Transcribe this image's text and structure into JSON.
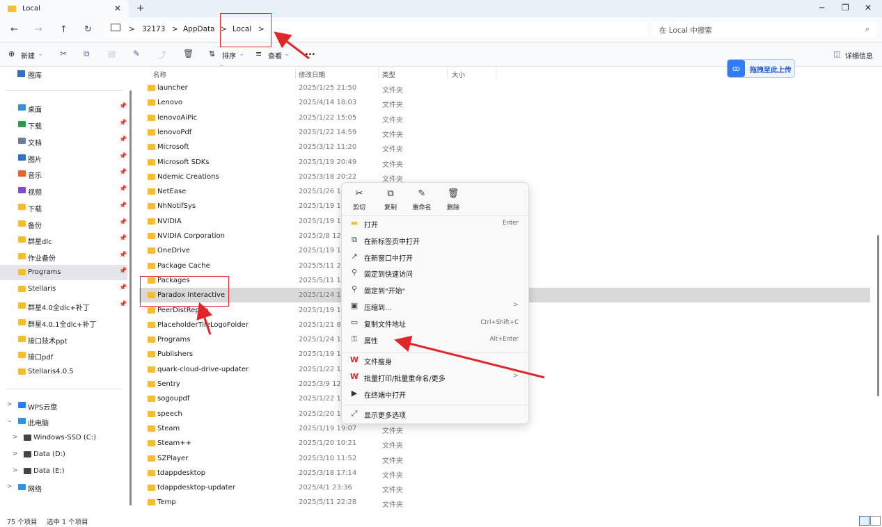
{
  "window": {
    "tab_title": "Local",
    "tab_close": "✕",
    "new_tab": "+",
    "minimize": "─",
    "maximize": "❐",
    "close": "✕"
  },
  "nav": {
    "back": "←",
    "forward": "→",
    "up": "↑",
    "refresh": "↻"
  },
  "breadcrumb": {
    "computer_icon": "monitor-icon",
    "sep": ">",
    "items": [
      "32173",
      "AppData",
      "Local"
    ]
  },
  "search": {
    "placeholder": "在 Local 中搜索",
    "icon": "⌕"
  },
  "toolbar": {
    "new_label": "新建",
    "sort_label": "排序",
    "view_label": "查看",
    "more_label": "...",
    "details_label": "详细信息"
  },
  "upload": {
    "label": "拖拽至此上传",
    "icon": "ꝏ"
  },
  "sidebar": {
    "gallery": "图库",
    "quick": [
      {
        "label": "桌面",
        "pinned": true,
        "color": "#3a8fd9"
      },
      {
        "label": "下载",
        "pinned": true,
        "color": "#2e9a4a"
      },
      {
        "label": "文档",
        "pinned": true,
        "color": "#6b7f99"
      },
      {
        "label": "图片",
        "pinned": true,
        "color": "#2f6fc4"
      },
      {
        "label": "音乐",
        "pinned": true,
        "color": "#e4632c"
      },
      {
        "label": "视频",
        "pinned": true,
        "color": "#7b4fd0"
      },
      {
        "label": "下载",
        "pinned": true,
        "color": "#f4bd34"
      },
      {
        "label": "备份",
        "pinned": true,
        "color": "#f4bd34"
      },
      {
        "label": "群星dlc",
        "pinned": true,
        "color": "#f4bd34"
      },
      {
        "label": "作业备份",
        "pinned": true,
        "color": "#f4bd34"
      },
      {
        "label": "Programs",
        "pinned": true,
        "color": "#f4bd34"
      },
      {
        "label": "Stellaris",
        "pinned": true,
        "color": "#f4bd34"
      },
      {
        "label": "群星4.0全dlc+补丁",
        "pinned": true,
        "color": "#f4bd34"
      },
      {
        "label": "群星4.0.1全dlc+补丁",
        "pinned": false,
        "color": "#f4bd34"
      },
      {
        "label": "接口技术ppt",
        "pinned": false,
        "color": "#f4bd34"
      },
      {
        "label": "接口pdf",
        "pinned": false,
        "color": "#f4bd34"
      },
      {
        "label": "Stellaris4.0.5",
        "pinned": false,
        "color": "#f4bd34"
      }
    ],
    "tree": [
      {
        "label": "WPS云盘",
        "chevron": ">",
        "indent": 0,
        "color": "#2f7cf6"
      },
      {
        "label": "此电脑",
        "chevron": "⌄",
        "indent": 0,
        "color": "#3a8fd9"
      },
      {
        "label": "Windows-SSD (C:)",
        "chevron": ">",
        "indent": 1,
        "color": "#444444"
      },
      {
        "label": "Data (D:)",
        "chevron": ">",
        "indent": 1,
        "color": "#444444"
      },
      {
        "label": "Data (E:)",
        "chevron": ">",
        "indent": 1,
        "color": "#444444"
      },
      {
        "label": "网络",
        "chevron": ">",
        "indent": 0,
        "color": "#3a8fd9"
      }
    ]
  },
  "columns": {
    "name": "名称",
    "date": "修改日期",
    "type": "类型",
    "size": "大小",
    "sort_indicator": "^"
  },
  "files": [
    {
      "name": "launcher",
      "date": "2025/1/25 21:50",
      "type": "文件夹"
    },
    {
      "name": "Lenovo",
      "date": "2025/4/14 18:03",
      "type": "文件夹"
    },
    {
      "name": "lenovoAiPic",
      "date": "2025/1/22 15:05",
      "type": "文件夹"
    },
    {
      "name": "lenovoPdf",
      "date": "2025/1/22 14:59",
      "type": "文件夹"
    },
    {
      "name": "Microsoft",
      "date": "2025/3/12 11:20",
      "type": "文件夹"
    },
    {
      "name": "Microsoft SDKs",
      "date": "2025/1/19 20:49",
      "type": "文件夹"
    },
    {
      "name": "Ndemic Creations",
      "date": "2025/3/18 20:22",
      "type": "文件夹"
    },
    {
      "name": "NetEase",
      "date": "2025/1/26 14:",
      "type": ""
    },
    {
      "name": "NhNotifSys",
      "date": "2025/1/19 18:",
      "type": ""
    },
    {
      "name": "NVIDIA",
      "date": "2025/1/19 18:",
      "type": ""
    },
    {
      "name": "NVIDIA Corporation",
      "date": "2025/2/8 12:5",
      "type": ""
    },
    {
      "name": "OneDrive",
      "date": "2025/1/19 18:",
      "type": ""
    },
    {
      "name": "Package Cache",
      "date": "2025/5/11 21:",
      "type": ""
    },
    {
      "name": "Packages",
      "date": "2025/5/11 18:",
      "type": ""
    },
    {
      "name": "Paradox Interactive",
      "date": "2025/1/24 18:",
      "type": "",
      "selected": true
    },
    {
      "name": "PeerDistRepub",
      "date": "2025/1/19 18:",
      "type": ""
    },
    {
      "name": "PlaceholderTileLogoFolder",
      "date": "2025/1/21 8:1",
      "type": ""
    },
    {
      "name": "Programs",
      "date": "2025/1/24 18:",
      "type": ""
    },
    {
      "name": "Publishers",
      "date": "2025/1/19 18:",
      "type": ""
    },
    {
      "name": "quark-cloud-drive-updater",
      "date": "2025/1/22 15:",
      "type": ""
    },
    {
      "name": "Sentry",
      "date": "2025/3/9 12:0",
      "type": ""
    },
    {
      "name": "sogoupdf",
      "date": "2025/1/22 14:",
      "type": ""
    },
    {
      "name": "speech",
      "date": "2025/2/20 10:",
      "type": ""
    },
    {
      "name": "Steam",
      "date": "2025/1/19 19:07",
      "type": "文件夹"
    },
    {
      "name": "Steam++",
      "date": "2025/1/20 10:21",
      "type": "文件夹"
    },
    {
      "name": "SZPlayer",
      "date": "2025/3/10 11:52",
      "type": "文件夹"
    },
    {
      "name": "tdappdesktop",
      "date": "2025/3/18 17:14",
      "type": "文件夹"
    },
    {
      "name": "tdappdesktop-updater",
      "date": "2025/4/1 23:36",
      "type": "文件夹"
    },
    {
      "name": "Temp",
      "date": "2025/5/11 22:28",
      "type": "文件夹"
    }
  ],
  "context_menu": {
    "quick_actions": [
      {
        "label": "剪切",
        "icon": "✂"
      },
      {
        "label": "复制",
        "icon": "⧉"
      },
      {
        "label": "重命名",
        "icon": "✎"
      },
      {
        "label": "删除",
        "icon": "🗑"
      }
    ],
    "items": [
      {
        "label": "打开",
        "shortcut": "Enter",
        "arrow": "",
        "icon": "▬",
        "color": "#f4bd34"
      },
      {
        "label": "在新标签页中打开",
        "shortcut": "",
        "arrow": "",
        "icon": "⧉",
        "color": "#444444"
      },
      {
        "label": "在新窗口中打开",
        "shortcut": "",
        "arrow": "",
        "icon": "↗",
        "color": "#444444"
      },
      {
        "label": "固定到快速访问",
        "shortcut": "",
        "arrow": "",
        "icon": "⚲",
        "color": "#444444"
      },
      {
        "label": "固定到\"开始\"",
        "shortcut": "",
        "arrow": "",
        "icon": "⚲",
        "color": "#444444"
      },
      {
        "label": "压缩到...",
        "shortcut": "",
        "arrow": ">",
        "icon": "▣",
        "color": "#444444"
      },
      {
        "label": "复制文件地址",
        "shortcut": "Ctrl+Shift+C",
        "arrow": "",
        "icon": "▭",
        "color": "#444444"
      },
      {
        "label": "属性",
        "shortcut": "Alt+Enter",
        "arrow": "",
        "icon": "⚿",
        "color": "#444444"
      }
    ],
    "extra_items": [
      {
        "label": "文件瘦身",
        "arrow": "",
        "icon": "W",
        "color": "#e0262b"
      },
      {
        "label": "批量打印/批量重命名/更多",
        "arrow": ">",
        "icon": "W",
        "color": "#e0262b"
      },
      {
        "label": "在终端中打开",
        "arrow": "",
        "icon": "▶",
        "color": "#333333"
      }
    ],
    "more_options": {
      "label": "显示更多选项",
      "icon": "⤢"
    }
  },
  "status": {
    "count": "75 个项目",
    "selected": "选中 1 个项目"
  },
  "colors": {
    "folder": "#f4bd34",
    "annotation_red": "#e0262b",
    "selection": "#d9d9d9"
  }
}
